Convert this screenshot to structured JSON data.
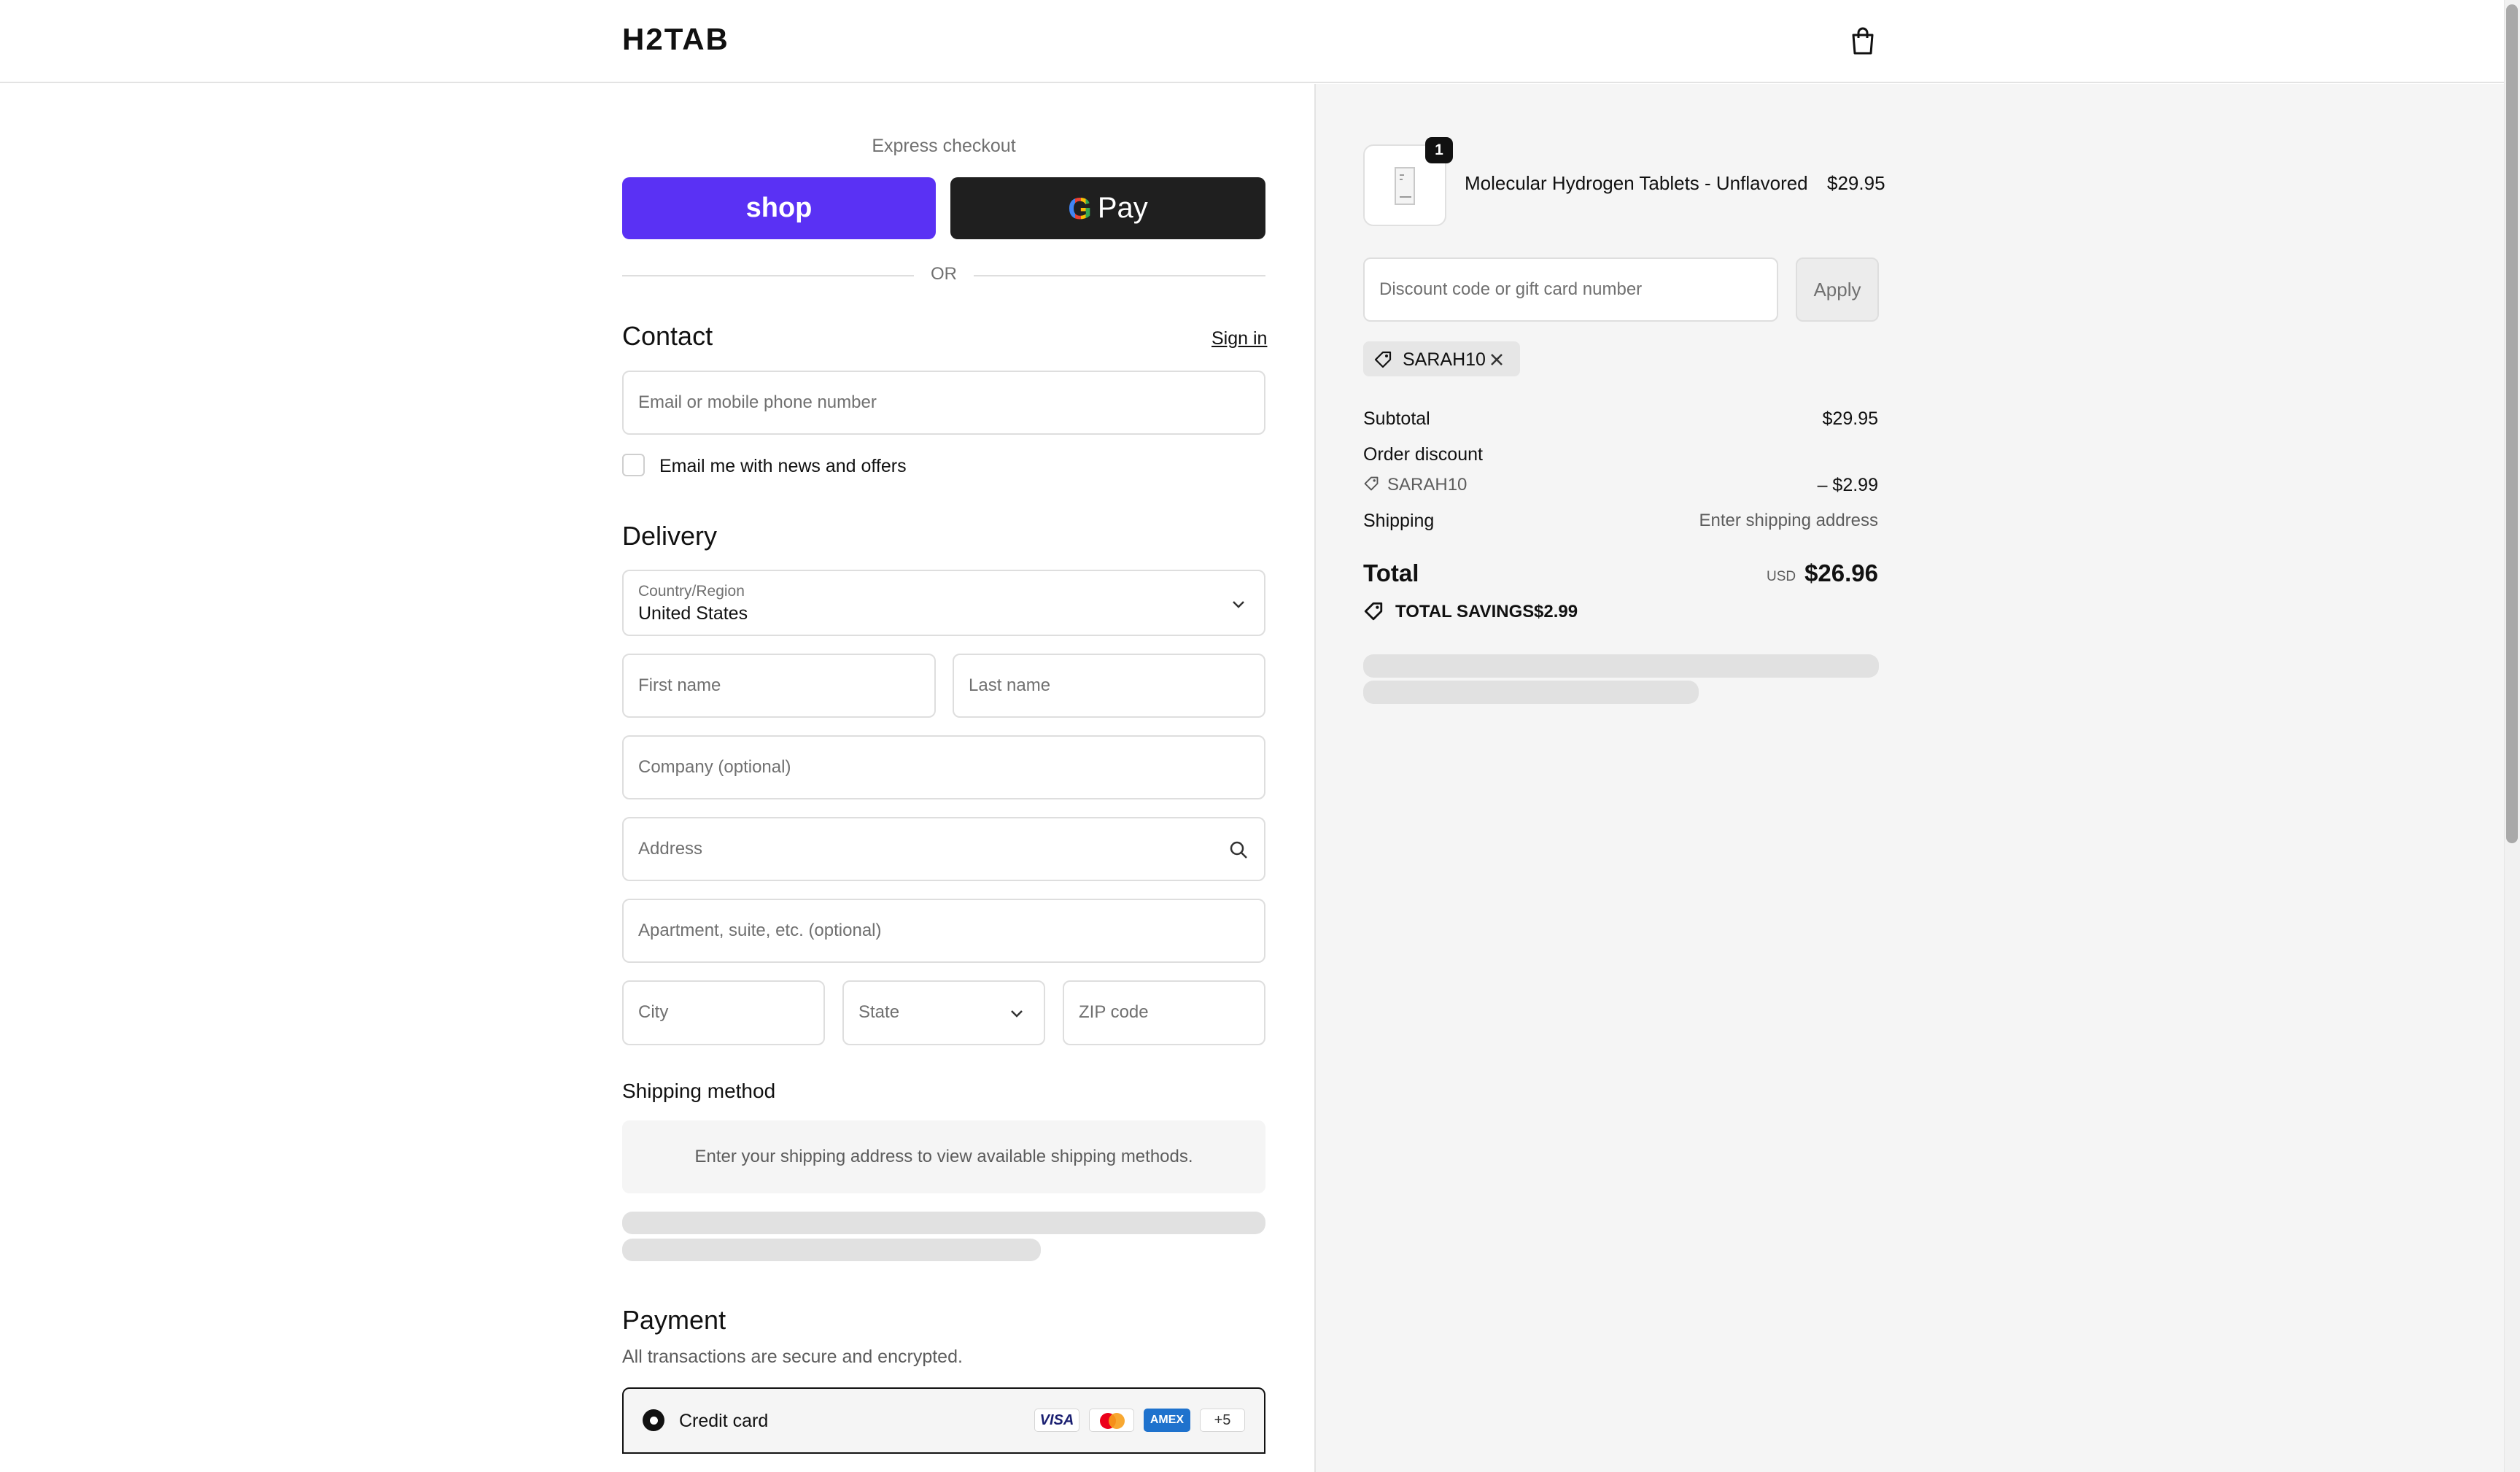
{
  "header": {
    "logo": "H2TAB",
    "cart_icon": "shopping-bag-icon"
  },
  "express": {
    "label": "Express checkout",
    "shop_label": "shop",
    "gpay_g": "G",
    "gpay_label": "Pay",
    "or_label": "OR"
  },
  "contact": {
    "title": "Contact",
    "sign_in": "Sign in",
    "email_placeholder": "Email or mobile phone number",
    "newsletter_label": "Email me with news and offers",
    "newsletter_checked": false
  },
  "delivery": {
    "title": "Delivery",
    "country_label": "Country/Region",
    "country_value": "United States",
    "first_name": "First name",
    "last_name": "Last name",
    "company": "Company (optional)",
    "address": "Address",
    "apartment": "Apartment, suite, etc. (optional)",
    "city": "City",
    "state": "State",
    "zip": "ZIP code"
  },
  "shipping_method": {
    "title": "Shipping method",
    "notice": "Enter your shipping address to view available shipping methods."
  },
  "payment": {
    "title": "Payment",
    "subtitle": "All transactions are secure and encrypted.",
    "option_label": "Credit card",
    "cards": [
      "VISA",
      "mastercard",
      "AMEX"
    ],
    "more_cards": "+5"
  },
  "summary": {
    "product": {
      "quantity": "1",
      "name": "Molecular Hydrogen Tablets - Unflavored",
      "price": "$29.95"
    },
    "discount_placeholder": "Discount code or gift card number",
    "apply_label": "Apply",
    "applied_code": "SARAH10",
    "subtotal_label": "Subtotal",
    "subtotal_value": "$29.95",
    "order_discount_label": "Order discount",
    "discount_code": "SARAH10",
    "discount_value": "– $2.99",
    "shipping_label": "Shipping",
    "shipping_value": "Enter shipping address",
    "total_label": "Total",
    "currency": "USD",
    "total_value": "$26.96",
    "savings_label": "TOTAL SAVINGS",
    "savings_value": "$2.99"
  },
  "colors": {
    "shop_purple": "#5a31f4",
    "gpay_black": "#1f1f1f",
    "sidebar_bg": "#f5f5f5"
  }
}
